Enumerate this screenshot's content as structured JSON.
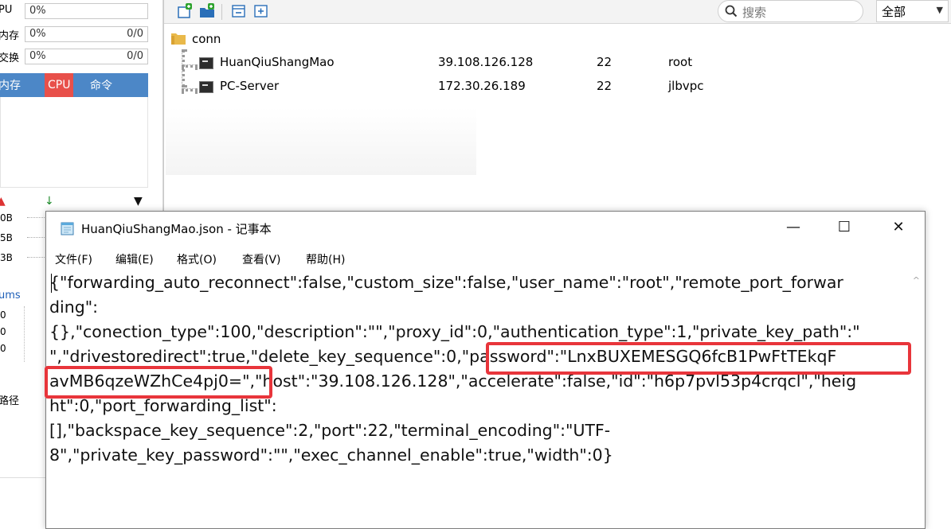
{
  "sidebar": {
    "metrics": [
      {
        "label": "PU",
        "percent": "0%",
        "ratio": ""
      },
      {
        "label": "内存",
        "percent": "0%",
        "ratio": "0/0"
      },
      {
        "label": "交换",
        "percent": "0%",
        "ratio": "0/0"
      }
    ],
    "tabs": {
      "memory": "内存",
      "cpu": "CPU",
      "command": "命令"
    },
    "net_values": [
      "0B",
      "5B",
      "3B"
    ],
    "ms_label": "ums",
    "ms_values": [
      "0",
      "0",
      "0"
    ],
    "path_label": "路径"
  },
  "manager": {
    "search_placeholder": "搜索",
    "filter_value": "全部",
    "folder": "conn",
    "sessions": [
      {
        "name": "HuanQiuShangMao",
        "host": "39.108.126.128",
        "port": "22",
        "user": "root"
      },
      {
        "name": "PC-Server",
        "host": "172.30.26.189",
        "port": "22",
        "user": "jlbvpc"
      }
    ]
  },
  "notepad": {
    "title": "HuanQiuShangMao.json - 记事本",
    "menu": [
      "文件(F)",
      "编辑(E)",
      "格式(O)",
      "查看(V)",
      "帮助(H)"
    ],
    "lines": [
      "{\"forwarding_auto_reconnect\":false,\"custom_size\":false,\"user_name\":\"root\",\"remote_port_forwar",
      "ding\":",
      "{},\"conection_type\":100,\"description\":\"\",\"proxy_id\":0,\"authentication_type\":1,\"private_key_path\":\"",
      "\",\"drivestoredirect\":true,\"delete_key_sequence\":0,\"password\":\"LnxBUXEMESGQ6fcB1PwFtTEkqF",
      "avMB6qzeWZhCe4pj0=\",\"host\":\"39.108.126.128\",\"accelerate\":false,\"id\":\"h6p7pvl53p4crqcl\",\"heig",
      "ht\":0,\"port_forwarding_list\":",
      "[],\"backspace_key_sequence\":2,\"port\":22,\"terminal_encoding\":\"UTF-",
      "8\",\"private_key_password\":\"\",\"exec_channel_enable\":true,\"width\":0}"
    ]
  },
  "colors": {
    "highlight": "#e8353b",
    "tab_blue": "#4c87c7",
    "tab_red": "#e8504a"
  }
}
